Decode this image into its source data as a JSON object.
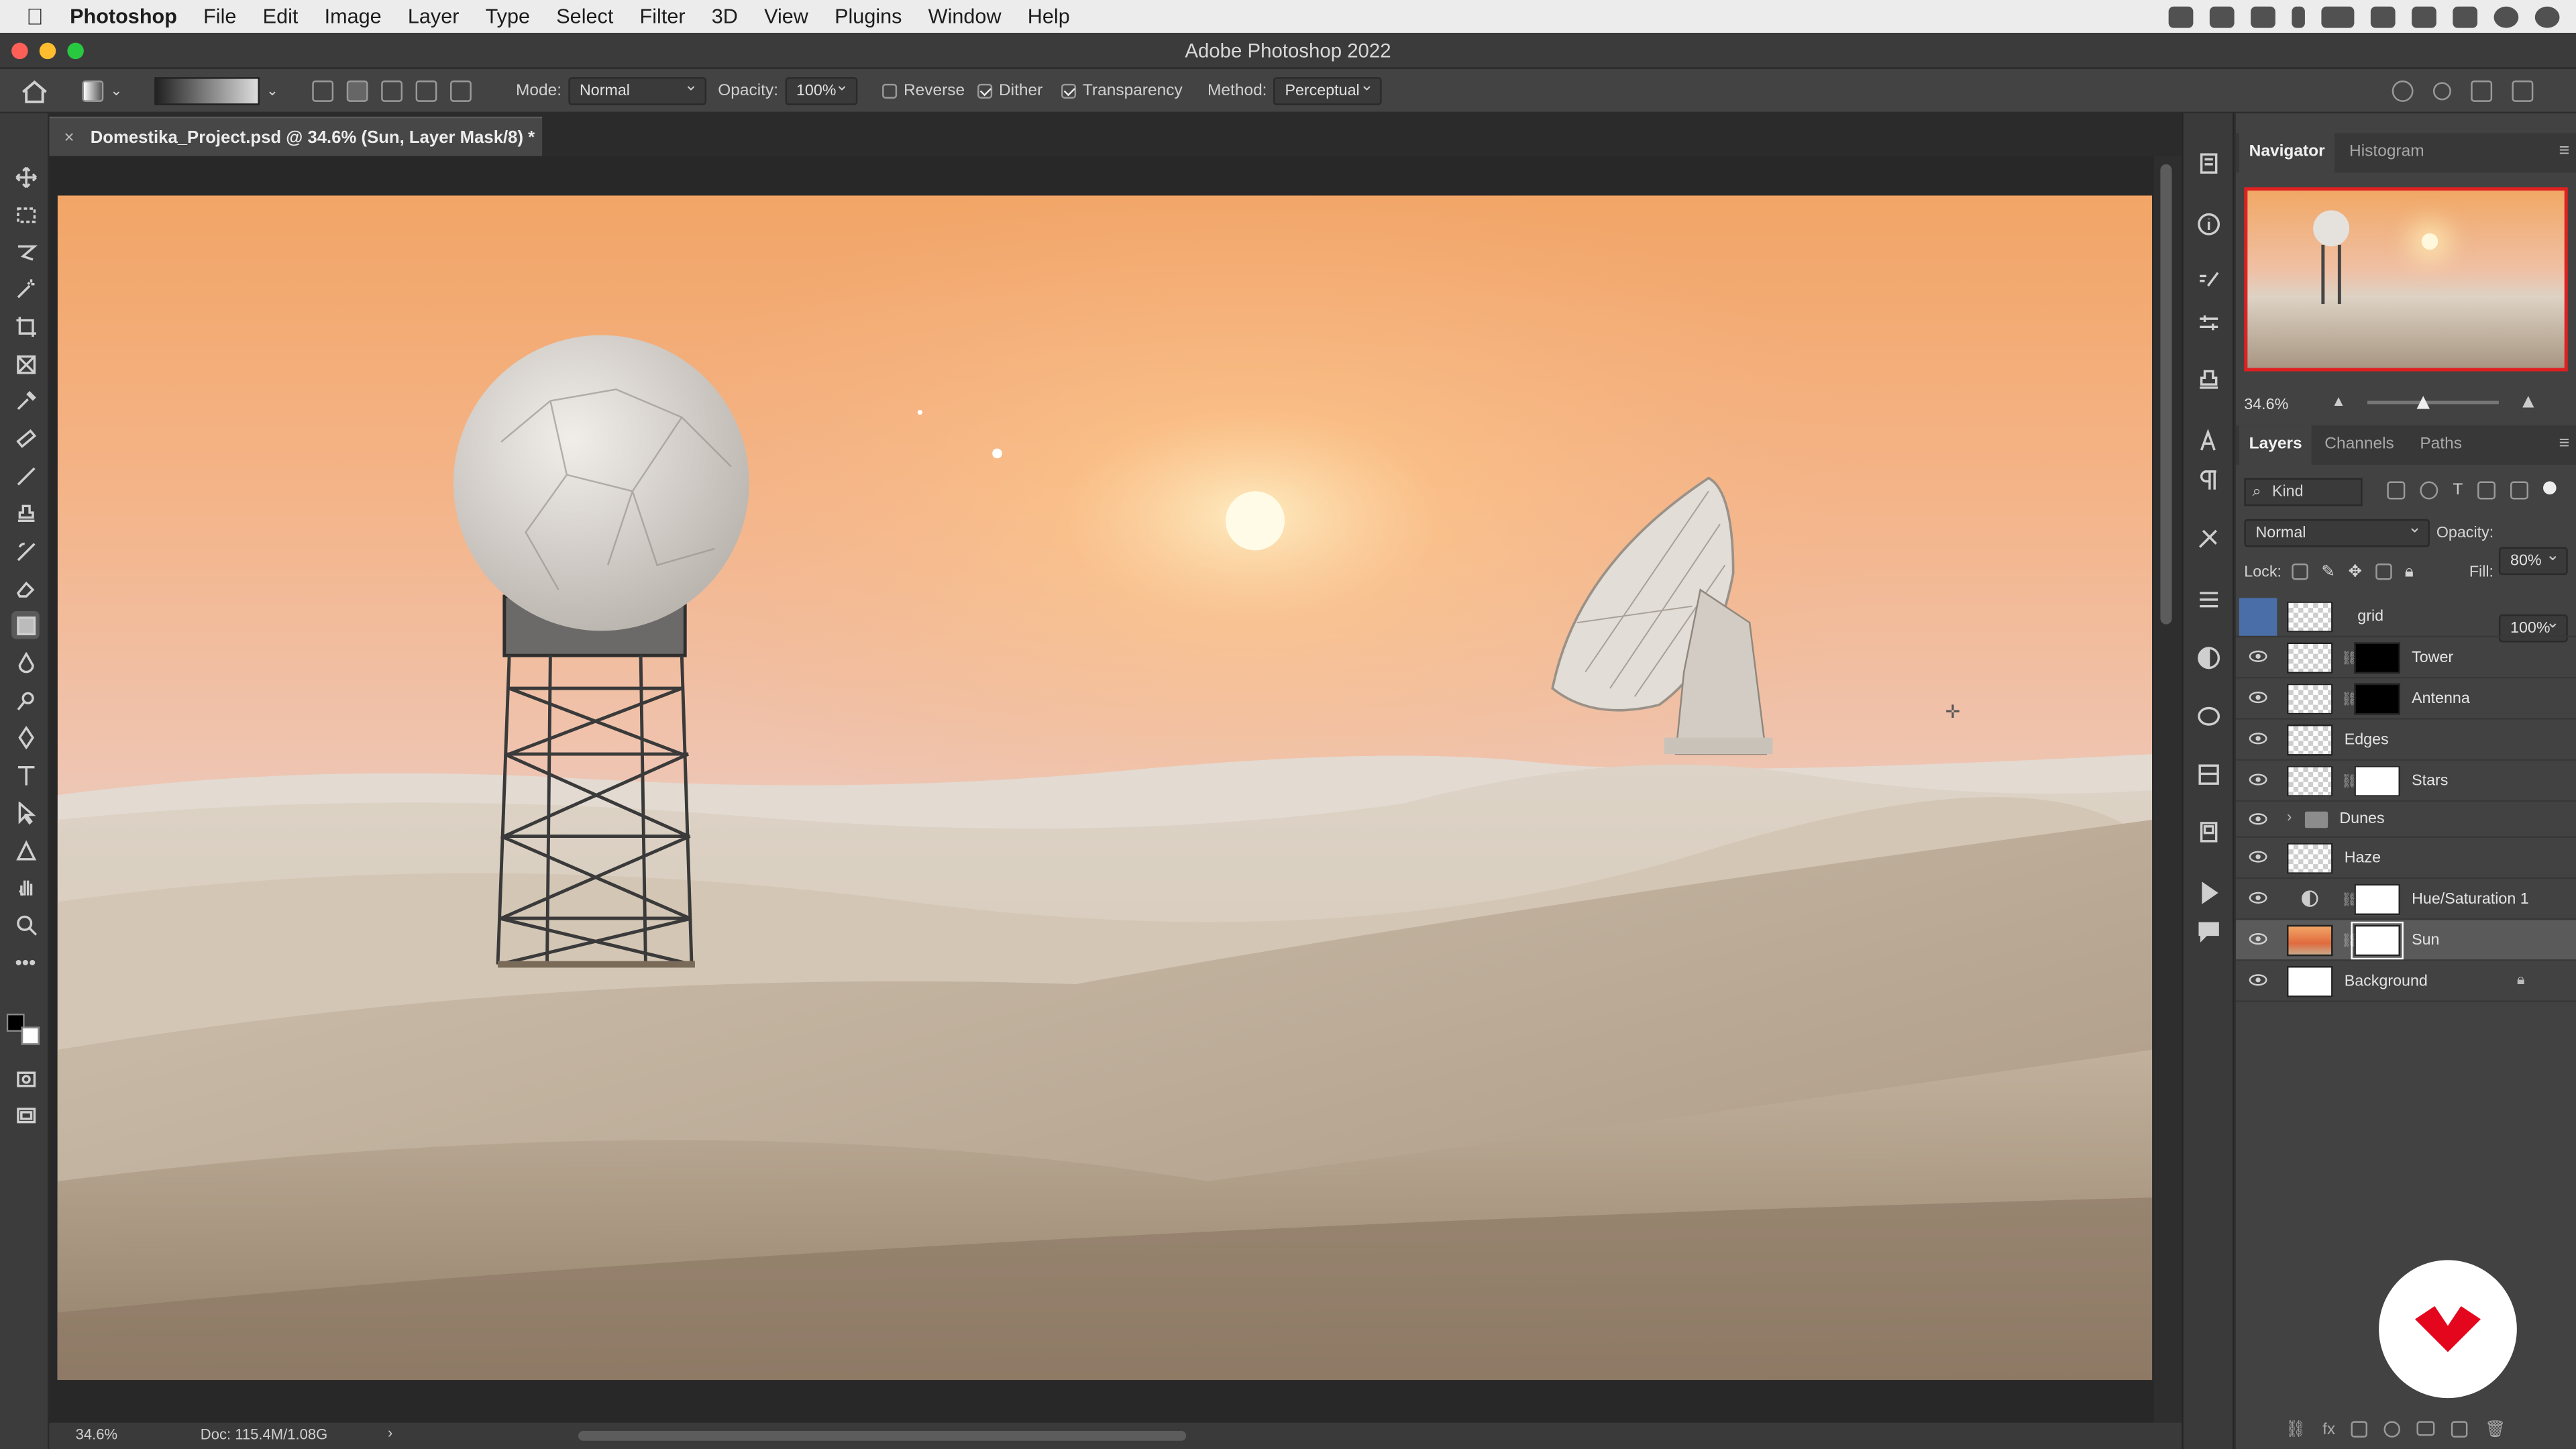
{
  "menubar": {
    "app": "Photoshop",
    "items": [
      "File",
      "Edit",
      "Image",
      "Layer",
      "Type",
      "Select",
      "Filter",
      "3D",
      "View",
      "Plugins",
      "Window",
      "Help"
    ]
  },
  "window": {
    "title": "Adobe Photoshop 2022"
  },
  "options": {
    "mode_label": "Mode:",
    "mode_value": "Normal",
    "opacity_label": "Opacity:",
    "opacity_value": "100%",
    "reverse_label": "Reverse",
    "reverse_checked": false,
    "dither_label": "Dither",
    "dither_checked": true,
    "transparency_label": "Transparency",
    "transparency_checked": true,
    "method_label": "Method:",
    "method_value": "Perceptual"
  },
  "document": {
    "tab_title": "Domestika_Project.psd @ 34.6% (Sun, Layer Mask/8) *",
    "zoom": "34.6%",
    "doc_size": "Doc: 115.4M/1.08G"
  },
  "navigator": {
    "tabs": [
      "Navigator",
      "Histogram"
    ],
    "zoom": "34.6%"
  },
  "layers_panel": {
    "tabs": [
      "Layers",
      "Channels",
      "Paths"
    ],
    "filter_kind": "Kind",
    "blend_mode": "Normal",
    "opacity_label": "Opacity:",
    "opacity_value": "80%",
    "lock_label": "Lock:",
    "fill_label": "Fill:",
    "fill_value": "100%",
    "layers": [
      {
        "name": "grid",
        "visible": false,
        "mask": "none"
      },
      {
        "name": "Tower",
        "visible": true,
        "mask": "black"
      },
      {
        "name": "Antenna",
        "visible": true,
        "mask": "black"
      },
      {
        "name": "Edges",
        "visible": true,
        "mask": "none"
      },
      {
        "name": "Stars",
        "visible": true,
        "mask": "white"
      },
      {
        "name": "Dunes",
        "visible": true,
        "mask": "group"
      },
      {
        "name": "Haze",
        "visible": true,
        "mask": "none"
      },
      {
        "name": "Hue/Saturation 1",
        "visible": true,
        "mask": "white"
      },
      {
        "name": "Sun",
        "visible": true,
        "mask": "white",
        "selected": true
      },
      {
        "name": "Background",
        "visible": true,
        "mask": "locked"
      }
    ]
  },
  "colors": {
    "accent": "#4a72b0",
    "brand": "#e4061d"
  }
}
